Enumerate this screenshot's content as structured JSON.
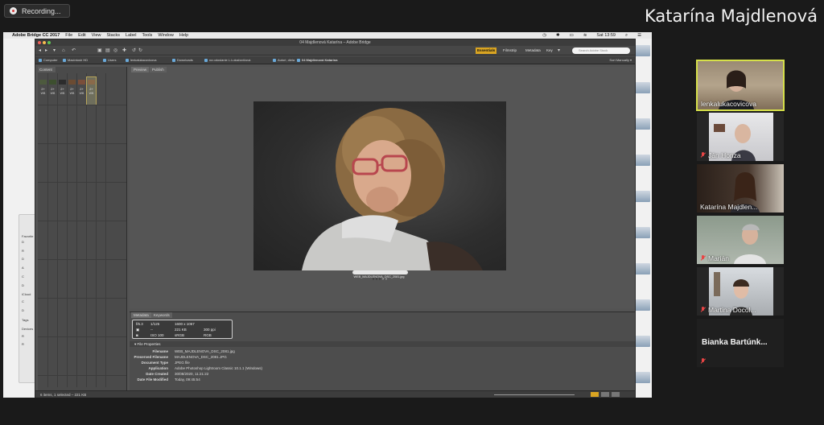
{
  "zoom": {
    "recording_label": "Recording...",
    "active_speaker": "Katarína Majdlenová",
    "participants": [
      {
        "name": "lenkalukacovicova",
        "muted": false
      },
      {
        "name": "Ján Honza",
        "muted": true
      },
      {
        "name": "Katarína Majdlen...",
        "muted": false
      },
      {
        "name": "Marián",
        "muted": true
      },
      {
        "name": "Martina Docol...",
        "muted": true
      },
      {
        "name": "Bianka Bartúnk...",
        "muted": true
      }
    ]
  },
  "mac_menubar": {
    "app_name": "Adobe Bridge CC 2017",
    "menus": [
      "File",
      "Edit",
      "View",
      "Stacks",
      "Label",
      "Tools",
      "Window",
      "Help"
    ],
    "clock": "Sat 13:59"
  },
  "finder_sidebar": {
    "items": [
      "Favorite",
      "D",
      "R",
      "D",
      "A",
      "C",
      "D",
      "iCloud",
      "C",
      "D",
      "Tags",
      "Devices",
      "R",
      "R"
    ]
  },
  "bridge": {
    "window_title": "04 Majdlenová Katarína – Adobe Bridge",
    "workspaces": [
      "Essentials",
      "Filmstrip",
      "Metadata",
      "Key"
    ],
    "active_workspace": "Essentials",
    "search_placeholder": "Search Adobe Stock",
    "path": [
      "Computer",
      "Macintosh HD",
      "Users",
      "lenkalukacovicova",
      "Downloads",
      "na odoslanie L.Lukačovičová",
      "Autori, diela",
      "04 Majdlenová Katarína"
    ],
    "sort_label": "Sort Manually",
    "content_tab": "Content",
    "thumbnails": [
      {
        "badge": "2+",
        "sub": "WB"
      },
      {
        "badge": "2+",
        "sub": "WB"
      },
      {
        "badge": "2+",
        "sub": "WB"
      },
      {
        "badge": "2+",
        "sub": "WB"
      },
      {
        "badge": "2+",
        "sub": "WB"
      },
      {
        "badge": "2+",
        "sub": "WB"
      }
    ],
    "preview_tabs": [
      "Preview",
      "Publish"
    ],
    "preview_caption": "WEB_MAJDLENOVA_DSC_2081.jpg",
    "metadata_tabs": [
      "Metadata",
      "Keywords"
    ],
    "placard": {
      "aperture": "f/6.3",
      "shutter": "1/125",
      "dimensions": "1600 x 1067",
      "filesize": "221 KB",
      "ppi": "300 ppi",
      "colorspace": "sRGB",
      "mode": "RGB",
      "iso": "ISO 100",
      "dash": "--"
    },
    "file_properties_title": "File Properties",
    "file_properties": [
      {
        "key": "Filename",
        "value": "WEB_MAJDLENOVA_DSC_2081.jpg"
      },
      {
        "key": "Preserved Filename",
        "value": "MAJDLENOVA_DSC_2081.JPG"
      },
      {
        "key": "Document Type",
        "value": "JPEG file"
      },
      {
        "key": "Application",
        "value": "Adobe Photoshop Lightroom Classic 10.1.1 (Windows)"
      },
      {
        "key": "Date Created",
        "value": "30/08/2020, 11:21:22"
      },
      {
        "key": "Date File Modified",
        "value": "Today, 09:45:54"
      }
    ],
    "status": "6 items, 1 selected – 221 KB"
  }
}
